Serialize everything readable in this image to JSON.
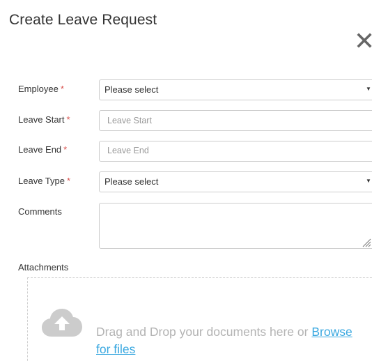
{
  "modal": {
    "title": "Create Leave Request",
    "close_icon": "close-icon"
  },
  "form": {
    "employee": {
      "label": "Employee",
      "required_mark": "*",
      "value": "Please select"
    },
    "leave_start": {
      "label": "Leave Start",
      "required_mark": "*",
      "placeholder": "Leave Start"
    },
    "leave_end": {
      "label": "Leave End",
      "required_mark": "*",
      "placeholder": "Leave End"
    },
    "leave_type": {
      "label": "Leave Type",
      "required_mark": "*",
      "value": "Please select"
    },
    "comments": {
      "label": "Comments"
    },
    "attachments": {
      "label": "Attachments",
      "drop_text": "Drag and Drop your documents here or",
      "browse_text": "Browse for files",
      "icon": "cloud-upload-icon"
    }
  },
  "colors": {
    "required": "#d9534f",
    "link": "#3aa8e0",
    "placeholder": "#999999",
    "border": "#cccccc"
  }
}
